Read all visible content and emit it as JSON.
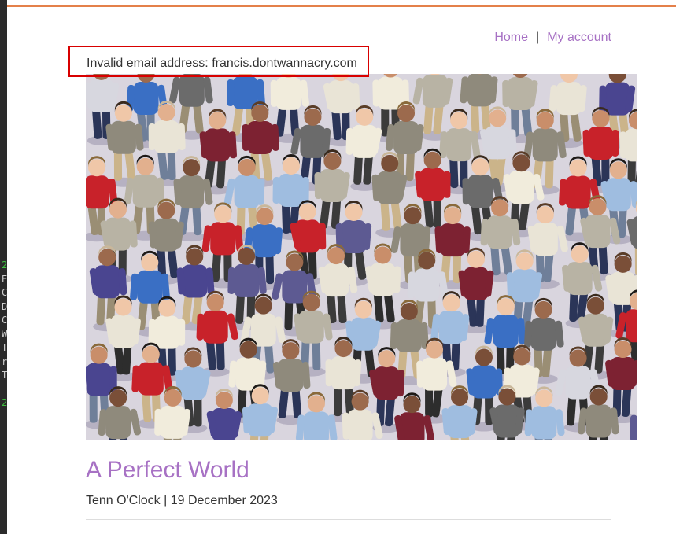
{
  "nav": {
    "home_label": "Home",
    "separator": "|",
    "account_label": "My account"
  },
  "alert": {
    "message": "Invalid email address: francis.dontwannacry.com"
  },
  "hero": {
    "image_name": "crowd-of-people-walking-image"
  },
  "post": {
    "title": "A Perfect World",
    "author": "Tenn O'Clock",
    "separator": "|",
    "date": "19 December 2023"
  },
  "colors": {
    "accent": "#a771c4",
    "top_bar": "#e4804a",
    "alert_border": "#d80000",
    "text": "#333333"
  }
}
